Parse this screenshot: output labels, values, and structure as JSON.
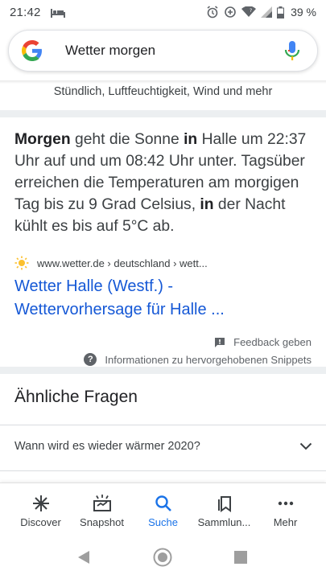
{
  "status": {
    "time": "21:42",
    "battery": "39 %"
  },
  "search": {
    "query": "Wetter morgen"
  },
  "subtitle": "Stündlich, Luftfeuchtigkeit, Wind und mehr",
  "snippet": {
    "p1": "Morgen",
    "p2": " geht die Sonne ",
    "p3": "in",
    "p4": " Halle um 22:37 Uhr auf und um 08:42 Uhr unter. Tagsüber erreichen die Temperaturen am morgigen Tag bis zu 9 Grad Celsius, ",
    "p5": "in",
    "p6": " der Nacht kühlt es bis auf 5°C ab."
  },
  "source": {
    "breadcrumb": "www.wetter.de › deutschland › wett..."
  },
  "result": {
    "title_line1": "Wetter Halle (Westf.) -",
    "title_line2": "Wettervorhersage für Halle ..."
  },
  "feedback": {
    "label": "Feedback geben"
  },
  "info": {
    "label": "Informationen zu hervorgehobenen Snippets"
  },
  "related": {
    "heading": "Ähnliche Fragen",
    "questions": [
      "Wann wird es wieder wärmer 2020?"
    ]
  },
  "bottom_nav": {
    "items": [
      {
        "label": "Discover",
        "icon": "asterisk-icon"
      },
      {
        "label": "Snapshot",
        "icon": "snapshot-icon"
      },
      {
        "label": "Suche",
        "icon": "search-icon",
        "active": true
      },
      {
        "label": "Sammlun...",
        "icon": "bookmark-icon"
      },
      {
        "label": "Mehr",
        "icon": "more-icon"
      }
    ]
  },
  "colors": {
    "accent": "#1a73e8",
    "link": "#1558d6"
  }
}
